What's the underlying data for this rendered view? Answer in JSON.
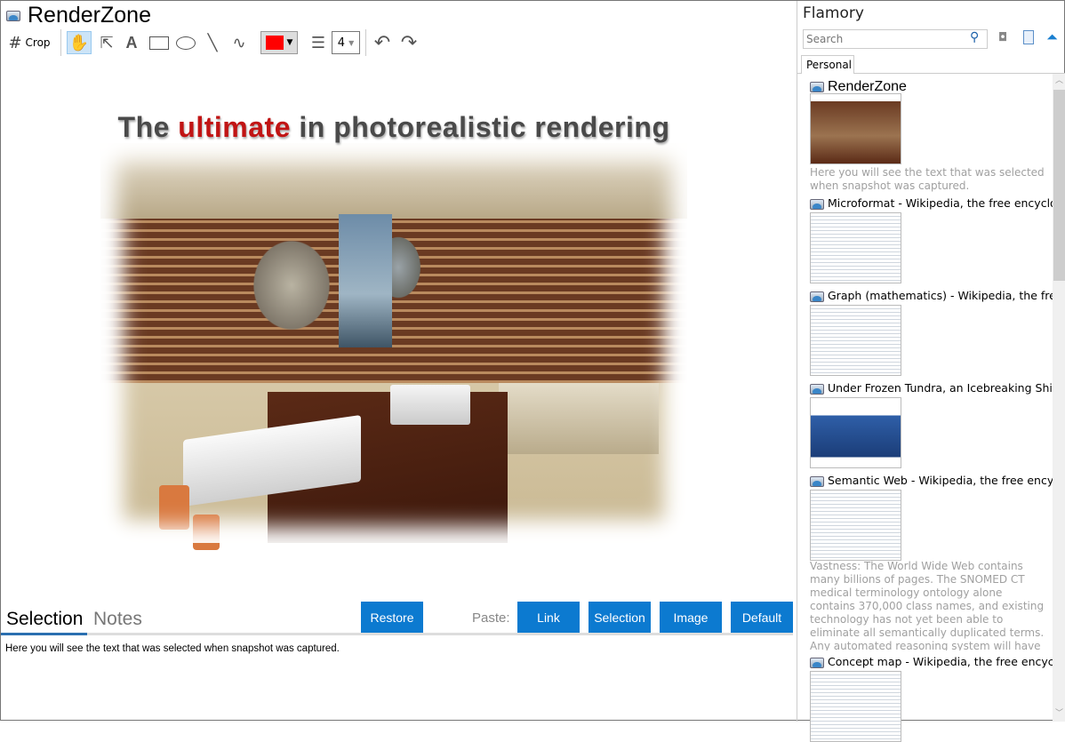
{
  "window": {
    "title": "RenderZone"
  },
  "toolbar": {
    "crop_label": "Crop",
    "stroke_width": "4",
    "color": "#ff0000",
    "tools": [
      "hand",
      "pointer",
      "text",
      "rectangle",
      "ellipse",
      "line",
      "freehand"
    ]
  },
  "snapshot": {
    "headline_pre": "The ",
    "headline_highlight": "ultimate",
    "headline_post": " in photorealistic rendering"
  },
  "bottom": {
    "tabs": [
      "Selection",
      "Notes"
    ],
    "active_tab": "Selection",
    "restore_label": "Restore",
    "paste_label": "Paste:",
    "paste_buttons": [
      "Link",
      "Selection",
      "Image",
      "Default"
    ],
    "selection_text": "Here you will see the text that was selected when snapshot was captured."
  },
  "sidebar": {
    "app_title": "Flamory",
    "search_placeholder": "Search",
    "tab": "Personal",
    "items": [
      {
        "title": "RenderZone",
        "desc": "Here you will see the text that was selected when snapshot was captured."
      },
      {
        "title": "Microformat - Wikipedia, the free encyclopedia"
      },
      {
        "title": "Graph (mathematics) - Wikipedia, the free encyclopedia"
      },
      {
        "title": "Under Frozen Tundra, an Icebreaking Ship Uncovers"
      },
      {
        "title": "Semantic Web - Wikipedia, the free encyclopedia",
        "desc": "Vastness: The World Wide Web contains many billions of pages. The SNOMED CT medical terminology ontology alone contains 370,000 class names, and existing technology has not yet been able to eliminate all semantically duplicated terms. Any automated reasoning system will have to deal with truly huge inputs."
      },
      {
        "title": "Concept map - Wikipedia, the free encyclopedia"
      }
    ]
  }
}
